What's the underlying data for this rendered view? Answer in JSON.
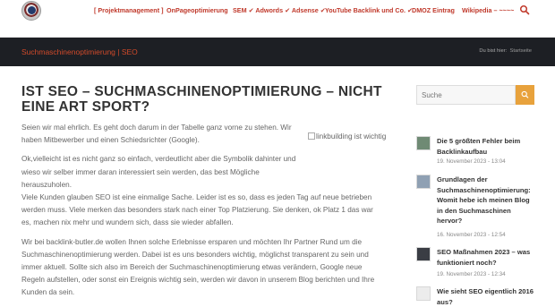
{
  "header": {
    "nav": [
      {
        "label": "[ Projektmanagement ]"
      },
      {
        "label": "OnPageoptimierung"
      },
      {
        "label": "SEM ✔ Adwords ✔ Adsense ✔"
      },
      {
        "label": "YouTube Backlink und Co. ✔"
      },
      {
        "label": "DMOZ Eintrag"
      },
      {
        "label": "Wikipedia – ~~~~"
      }
    ],
    "search_icon": "search-icon",
    "accent_color": "#c0392b"
  },
  "titlebar": {
    "site_title": "Suchmaschinenoptimierung | SEO",
    "breadcrumb_prefix": "Du bist hier:",
    "breadcrumb_current": "Startseite"
  },
  "article": {
    "title": "IST SEO – SUCHMASCHINENOPTIMIERUNG – NICHT EINE ART SPORT?",
    "image_alt": "linkbuilding ist wichtig",
    "paragraphs": [
      "Seien wir mal ehrlich. Es geht doch darum in der Tabelle ganz vorne zu stehen. Wir haben Mitbewerber und einen Schiedsrichter (Google).",
      "Ok,vielleicht ist es nicht ganz so einfach, verdeutlicht aber die Symbolik dahinter und wieso wir selber immer daran interessiert sein werden, das best Mögliche herauszuholen.",
      "Viele Kunden glauben SEO ist eine einmalige Sache. Leider ist es so, dass es jeden Tag auf neue betrieben werden muss. Viele merken das besonders stark nach einer Top Platzierung. Sie denken, ok Platz 1 das war es, machen nix mehr und wundern sich, dass sie wieder abfallen.",
      "Wir bei backlink-butler.de wollen Ihnen solche Erlebnisse ersparen und möchten Ihr Partner Rund um die Suchmaschinenoptimierung werden. Dabei ist es uns besonders wichtig, möglichst transparent zu sein und immer aktuell. Sollte sich also im Bereich der Suchmaschinenoptimierung etwas verändern, Google neue Regeln aufstellen, oder sonst ein Ereignis wichtig sein, werden wir davon in unserem Blog berichten und Ihre Kunden da sein."
    ]
  },
  "sidebar": {
    "search_placeholder": "Suche",
    "search_button_color": "#e8a23c",
    "posts": [
      {
        "title": "Die 5 größten Fehler beim Backlinkaufbau",
        "date": "19. November 2023 - 13:04"
      },
      {
        "title": "Grundlagen der Suchmaschinenoptimierung: Womit hebe ich meinen Blog in den Suchmaschinen hervor?",
        "date": "16. November 2023 - 12:54"
      },
      {
        "title": "SEO Maßnahmen 2023 – was funktioniert noch?",
        "date": "19. November 2023 - 12:34"
      },
      {
        "title": "Wie sieht SEO eigentlich 2016 aus?",
        "date": ""
      }
    ]
  }
}
